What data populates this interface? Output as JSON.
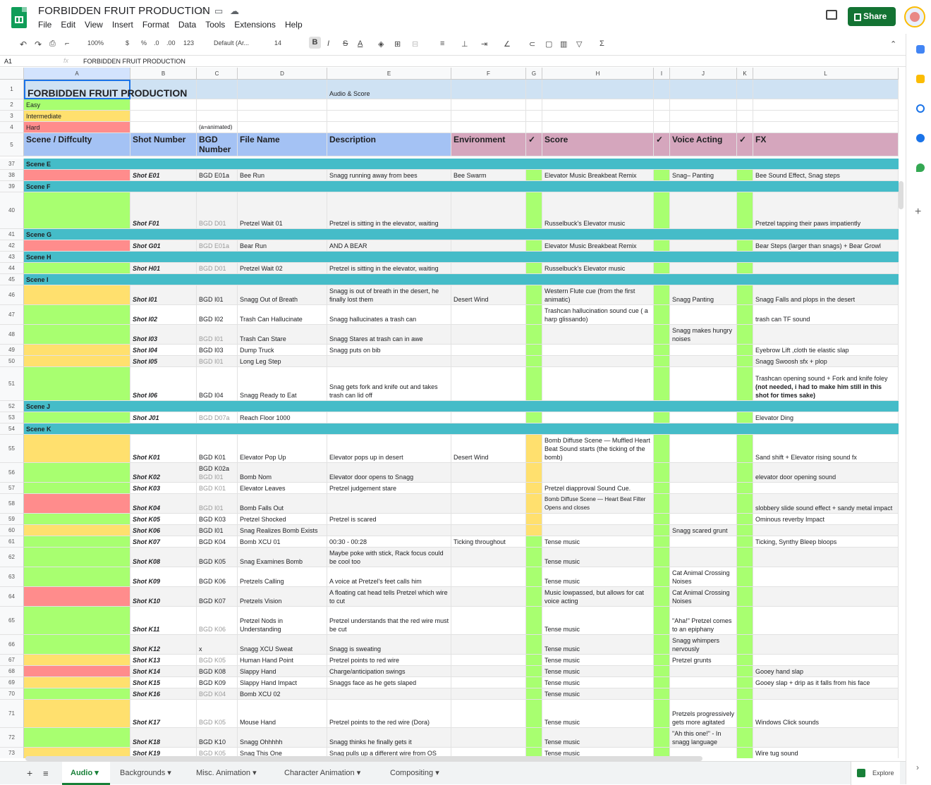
{
  "app": {
    "title": "FORBIDDEN FRUIT PRODUCTION",
    "share_label": "Share",
    "menus": [
      "File",
      "Edit",
      "View",
      "Insert",
      "Format",
      "Data",
      "Tools",
      "Extensions",
      "Help"
    ]
  },
  "toolbar": {
    "zoom": "100%",
    "currency": "$",
    "percent": "%",
    "dec_less": ".0",
    "dec_more": ".00",
    "number_format": "123",
    "font": "Default (Ar...",
    "font_size": "14",
    "bold": "B",
    "italic": "I",
    "strike": "S",
    "textcolor": "A"
  },
  "formula": {
    "cell_ref": "A1",
    "fx": "fx",
    "value": "FORBIDDEN FRUIT PRODUCTION"
  },
  "columns": [
    "A",
    "B",
    "C",
    "D",
    "E",
    "F",
    "G",
    "H",
    "I",
    "J",
    "K",
    "L"
  ],
  "top_rows": {
    "r1": {
      "num": "1",
      "a": "FORBIDDEN FRUIT PRODUCTION",
      "e": "Audio & Score"
    },
    "r2": {
      "num": "2",
      "a": "Easy"
    },
    "r3": {
      "num": "3",
      "a": "Intermediate"
    },
    "r4": {
      "num": "4",
      "a": "Hard",
      "c": "(a=animated)"
    },
    "r5": {
      "num": "5",
      "a": "Scene / Diffculty",
      "b": "Shot Number",
      "c": "BGD Number",
      "d": "File Name",
      "e": "Description",
      "f": "Environment",
      "g": "✓",
      "h": "Score",
      "i": "✓",
      "j": "Voice Acting",
      "k": "✓",
      "l": "FX"
    }
  },
  "rows": [
    {
      "num": "37",
      "scene": "Scene E"
    },
    {
      "num": "38",
      "diff": "hard",
      "shot": "Shot E01",
      "bgd": "BGD E01a",
      "file": "Bee Run",
      "desc": "Snagg running away from bees",
      "env": "Bee Swarm",
      "score": "Elevator Music Breakbeat Remix",
      "voice": "Snag– Panting",
      "fx": "Bee Sound Effect, Snag steps"
    },
    {
      "num": "39",
      "scene": "Scene F"
    },
    {
      "num": "40",
      "diff": "easy",
      "shot": "Shot F01",
      "bgd": "BGD D01",
      "bgdgray": true,
      "file": "Pretzel Wait 01",
      "desc": "Pretzel is sitting in the elevator, waiting",
      "score": "Russelbuck's Elevator music",
      "fx": "Pretzel tapping their paws impatiently"
    },
    {
      "num": "41",
      "scene": "Scene G"
    },
    {
      "num": "42",
      "diff": "hard",
      "shot": "Shot G01",
      "bgd": "BGD E01a",
      "bgdgray": true,
      "file": "Bear Run",
      "desc": "AND A BEAR",
      "score": "Elevator Music Breakbeat Remix",
      "fx": "Bear Steps (larger than snags) + Bear Growl"
    },
    {
      "num": "43",
      "scene": "Scene H"
    },
    {
      "num": "44",
      "diff": "easy",
      "shot": "Shot H01",
      "bgd": "BGD D01",
      "bgdgray": true,
      "file": "Pretzel Wait 02",
      "desc": "Pretzel is sitting in the elevator, waiting",
      "score": "Russelbuck's Elevator music"
    },
    {
      "num": "45",
      "scene": "Scene I"
    },
    {
      "num": "46",
      "diff": "inter",
      "shot": "Shot I01",
      "bgd": "BGD I01",
      "file": "Snagg Out of Breath",
      "desc": "Snagg is out of breath in the desert, he finally lost them",
      "env": "Desert Wind",
      "score": "Western Flute cue (from the first animatic)",
      "voice": "Snagg Panting",
      "fx": "Snagg Falls and plops in the desert"
    },
    {
      "num": "47",
      "diff": "easy",
      "shot": "Shot I02",
      "bgd": "BGD I02",
      "file": "Trash Can Hallucinate",
      "desc": "Snagg hallucinates a trash can",
      "score": "Trashcan hallucination sound cue ( a harp glissando)",
      "fx": "trash can TF sound"
    },
    {
      "num": "48",
      "diff": "easy",
      "shot": "Shot I03",
      "bgd": "BGD I01",
      "bgdgray": true,
      "file": "Trash Can Stare",
      "desc": "Snagg Stares at trash can in awe",
      "voice": "Snagg makes hungry noises"
    },
    {
      "num": "49",
      "diff": "inter",
      "shot": "Shot I04",
      "bgd": "BGD I03",
      "file": "Dump Truck",
      "desc": "Snagg puts on bib",
      "fx": "Eyebrow Lift ,cloth tie elastic slap"
    },
    {
      "num": "50",
      "diff": "inter",
      "shot": "Shot I05",
      "bgd": "BGD I01",
      "bgdgray": true,
      "file": "Long Leg Step",
      "fx": "Snagg Swoosh sfx + plop"
    },
    {
      "num": "51",
      "diff": "easy",
      "shot": "Shot I06",
      "bgd": "BGD I04",
      "file": "Snagg Ready to Eat",
      "desc": "Snag gets fork and knife out and takes trash can lid off",
      "fx": "Trashcan opening sound + Fork and knife foley",
      "fxbold": "(not needed, i had to make him still in this shot for times sake)"
    },
    {
      "num": "52",
      "scene": "Scene J"
    },
    {
      "num": "53",
      "diff": "easy",
      "shot": "Shot J01",
      "bgd": "BGD D07a",
      "bgdgray": true,
      "file": "Reach Floor 1000",
      "fx": "Elevator Ding"
    },
    {
      "num": "54",
      "scene": "Scene K"
    },
    {
      "num": "55",
      "diff": "inter",
      "gy": true,
      "shot": "Shot K01",
      "bgd": "BGD K01",
      "file": "Elevator Pop Up",
      "desc": "Elevator pops up in desert",
      "env": "Desert Wind",
      "score": "Bomb Diffuse Scene — Muffled Heart Beat Sound starts (the ticking of the bomb)",
      "fx": "Sand shift + Elevator rising sound fx"
    },
    {
      "num": "56",
      "diff": "easy",
      "gy": true,
      "shot": "Shot K02",
      "bgd": "BGD K02a",
      "bgd2": "BGD I01",
      "file": "Bomb Nom",
      "desc": "Elevator door opens to Snagg",
      "fx": "elevator door opening sound"
    },
    {
      "num": "57",
      "diff": "easy",
      "gy": true,
      "shot": "Shot K03",
      "bgd": "BGD K01",
      "bgdgray": true,
      "file": "Elevator Leaves",
      "desc": "Pretzel judgement stare",
      "score": "Pretzel diapproval Sound Cue."
    },
    {
      "num": "58",
      "diff": "hard",
      "gy": true,
      "shot": "Shot K04",
      "bgd": "BGD I01",
      "bgdgray": true,
      "file": "Bomb Falls Out",
      "score": "Bomb Diffuse Scene — Heart Beat Filter Opens and closes",
      "scoresmall": true,
      "fx": "slobbery slide sound effect + sandy metal impact"
    },
    {
      "num": "59",
      "diff": "easy",
      "gy": true,
      "shot": "Shot K05",
      "bgd": "BGD K03",
      "file": "Pretzel Shocked",
      "desc": "Pretzel is scared",
      "fx": "Ominous reverby Impact"
    },
    {
      "num": "60",
      "diff": "inter",
      "gy": true,
      "shot": "Shot K06",
      "bgd": "BGD I01",
      "file": "Snag Realizes Bomb Exists",
      "voice": "Snagg scared grunt"
    },
    {
      "num": "61",
      "diff": "easy",
      "shot": "Shot K07",
      "bgd": "BGD K04",
      "file": "Bomb XCU 01",
      "desc": "00:30 - 00:28",
      "env": "Ticking throughout",
      "score": "Tense music",
      "fx": "Ticking, Synthy Bleep bloops"
    },
    {
      "num": "62",
      "diff": "easy",
      "shot": "Shot K08",
      "bgd": "BGD K05",
      "file": "Snag Examines Bomb",
      "desc": "Maybe poke with stick, Rack focus could be cool too",
      "score": "Tense music"
    },
    {
      "num": "63",
      "diff": "easy",
      "shot": "Shot K09",
      "bgd": "BGD K06",
      "file": "Pretzels Calling",
      "desc": "A voice at Pretzel's feet calls him",
      "score": "Tense music",
      "voice": "Cat Animal Crossing Noises"
    },
    {
      "num": "64",
      "diff": "hard",
      "shot": "Shot K10",
      "bgd": "BGD K07",
      "file": "Pretzels Vision",
      "desc": "A floating cat head tells Pretzel which wire to cut",
      "score": "Music lowpassed, but allows for cat voice acting",
      "voice": "Cat Animal Crossing Noises"
    },
    {
      "num": "65",
      "diff": "easy",
      "shot": "Shot K11",
      "bgd": "BGD K06",
      "bgdgray": true,
      "file": "Pretzel Nods in Understanding",
      "desc": "Pretzel understands that the red wire must be cut",
      "score": "Tense music",
      "voice": "\"Aha!\" Pretzel comes to an epiphany"
    },
    {
      "num": "66",
      "diff": "easy",
      "shot": "Shot K12",
      "bgd": "x",
      "file": "Snagg XCU Sweat",
      "desc": "Snagg is sweating",
      "score": "Tense music",
      "voice": "Snagg whimpers nervously"
    },
    {
      "num": "67",
      "diff": "inter",
      "shot": "Shot K13",
      "bgd": "BGD K05",
      "bgdgray": true,
      "file": "Human Hand Point",
      "desc": "Pretzel points to red wire",
      "score": "Tense music",
      "voice": "Pretzel grunts"
    },
    {
      "num": "68",
      "diff": "hard",
      "shot": "Shot K14",
      "bgd": "BGD K08",
      "file": "Slappy Hand",
      "desc": "Charge/anticipation swings",
      "score": "Tense music",
      "fx": "Gooey hand slap"
    },
    {
      "num": "69",
      "diff": "inter",
      "shot": "Shot K15",
      "bgd": "BGD K09",
      "file": "Slappy Hand Impact",
      "desc": "Snaggs face as he gets slaped",
      "score": "Tense music",
      "fx": "Gooey slap + drip as it falls from his face"
    },
    {
      "num": "70",
      "diff": "easy",
      "shot": "Shot K16",
      "bgd": "BGD K04",
      "bgdgray": true,
      "file": "Bomb XCU 02",
      "score": "Tense music"
    },
    {
      "num": "71",
      "diff": "inter",
      "shot": "Shot K17",
      "bgd": "BGD K05",
      "bgdgray": true,
      "file": "Mouse Hand",
      "desc": "Pretzel points to the red wire (Dora)",
      "score": "Tense music",
      "voice": "Pretzels progressively gets more agitated",
      "fx": "Windows Click sounds"
    },
    {
      "num": "72",
      "diff": "easy",
      "shot": "Shot K18",
      "bgd": "BGD K10",
      "file": "Snagg Ohhhhh",
      "desc": "Snagg thinks he finally gets it",
      "score": "Tense music",
      "voice": "\"Ah this one!\" - In snagg language"
    },
    {
      "num": "73",
      "diff": "inter",
      "shot": "Shot K19",
      "bgd": "BGD K05",
      "bgdgray": true,
      "file": "Snag This One",
      "desc": "Snag pulls up a different wire from OS",
      "score": "Tense music",
      "fx": "Wire tug sound"
    }
  ],
  "tabs": [
    "Audio",
    "Backgrounds",
    "Misc. Animation",
    "Character Animation",
    "Compositing"
  ],
  "explore_label": "Explore",
  "colors": {
    "easy": "#a8ff70",
    "inter": "#ffe06e",
    "hard": "#ff8c8c",
    "scene": "#45bcc8",
    "hdr_blue": "#a4c2f4",
    "hdr_pink": "#d5a6bd",
    "title_bg": "#cfe2f3"
  }
}
